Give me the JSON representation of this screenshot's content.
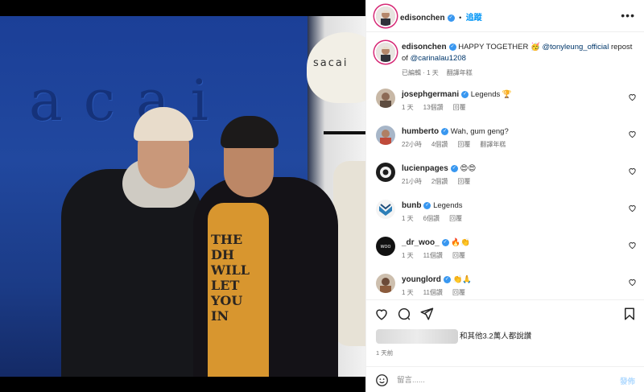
{
  "post": {
    "author": "edisonchen",
    "follow_label": "追蹤",
    "more_label": "•••"
  },
  "photo": {
    "wall_text": "acai",
    "lamp_text": "sacai",
    "shirt_lines": [
      "THE",
      "DH",
      "WILL",
      "LET",
      "YOU",
      "IN"
    ]
  },
  "caption": {
    "author": "edisonchen",
    "text_prefix": "HAPPY TOGETHER 🥳 ",
    "mention1": "@tonyleung_official",
    "text_mid": " repost of ",
    "mention2": "@carinalau1208",
    "edited": "已編輯 · 1 天",
    "translate": "翻譯年糕"
  },
  "comments": [
    {
      "user": "josephgermani",
      "text": "Legends 🏆",
      "time": "1 天",
      "likes": "13個讚",
      "reply": "回覆",
      "translate": ""
    },
    {
      "user": "humberto",
      "text": "Wah, gum geng?",
      "time": "22小時",
      "likes": "4個讚",
      "reply": "回覆",
      "translate": "翻譯年糕"
    },
    {
      "user": "lucienpages",
      "text": "😍😍",
      "time": "21小時",
      "likes": "2個讚",
      "reply": "回覆",
      "translate": ""
    },
    {
      "user": "bunb",
      "text": "Legends",
      "time": "1 天",
      "likes": "6個讚",
      "reply": "回覆",
      "translate": ""
    },
    {
      "user": "_dr_woo_",
      "text": "🔥👏",
      "time": "1 天",
      "likes": "11個讚",
      "reply": "回覆",
      "translate": ""
    },
    {
      "user": "younglord",
      "text": "👏🙏",
      "time": "1 天",
      "likes": "11個讚",
      "reply": "回覆",
      "translate": ""
    }
  ],
  "footer": {
    "likes_text": "和其他3.2萬人都說讚",
    "time": "1 天前",
    "comment_placeholder": "留言......",
    "post_label": "發佈"
  },
  "colors": {
    "accent": "#0095f6",
    "verified": "#3897f0",
    "story_ring": "#d62976"
  },
  "icons": [
    "heart-icon",
    "comment-icon",
    "share-icon",
    "bookmark-icon",
    "emoji-icon",
    "verified-icon",
    "more-icon"
  ]
}
